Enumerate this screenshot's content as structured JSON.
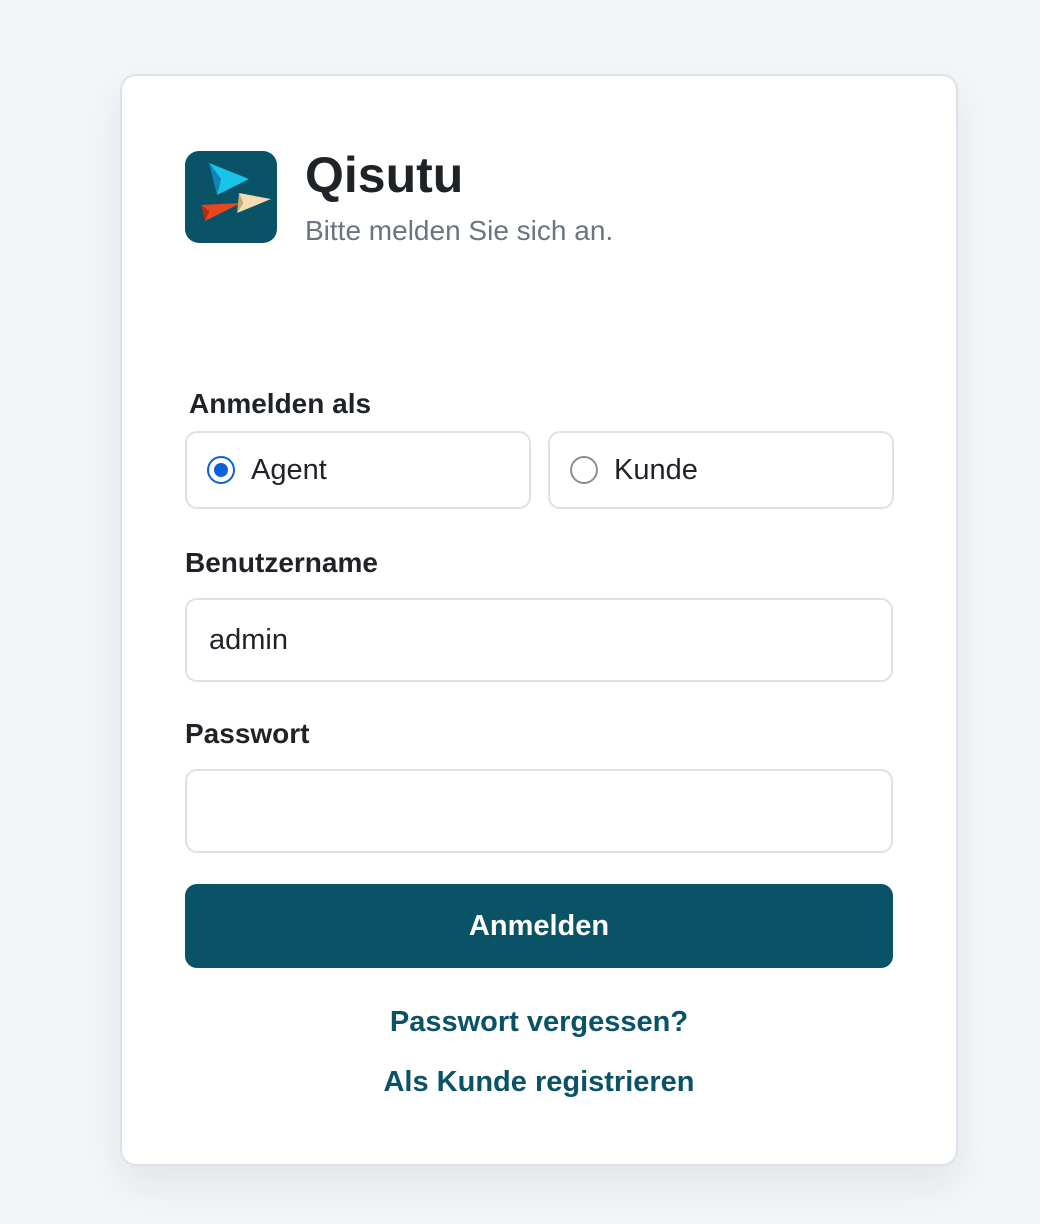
{
  "brand": {
    "name": "Qisutu",
    "subtitle": "Bitte melden Sie sich an.",
    "logo_icon": "paper-planes-logo",
    "logo_bg": "#0a5366"
  },
  "login_as": {
    "label": "Anmelden als",
    "options": [
      {
        "label": "Agent",
        "checked": true
      },
      {
        "label": "Kunde",
        "checked": false
      }
    ]
  },
  "username": {
    "label": "Benutzername",
    "value": "admin"
  },
  "password": {
    "label": "Passwort",
    "value": ""
  },
  "submit_label": "Anmelden",
  "links": {
    "forgot": "Passwort vergessen?",
    "register": "Als Kunde registrieren"
  },
  "colors": {
    "primary": "#0a5366",
    "radio_accent": "#0b62d6",
    "page_bg": "#f3f5f8"
  }
}
